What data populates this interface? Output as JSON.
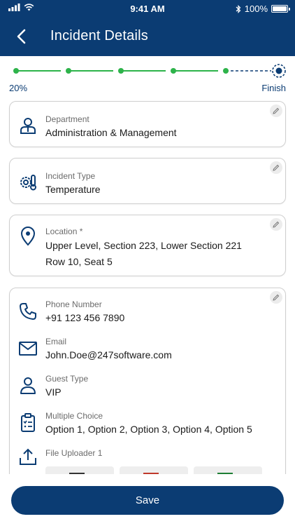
{
  "status_bar": {
    "time": "9:41 AM",
    "battery": "100%"
  },
  "header": {
    "title": "Incident Details"
  },
  "progress": {
    "start_label": "20%",
    "end_label": "Finish",
    "fraction": 0.2
  },
  "cards": {
    "department": {
      "label": "Department",
      "value": "Administration & Management"
    },
    "incident_type": {
      "label": "Incident Type",
      "value": "Temperature"
    },
    "location": {
      "label": "Location *",
      "line1": "Upper Level, Section 223, Lower Section 221",
      "line2": "Row 10,  Seat 5"
    },
    "contact": {
      "phone": {
        "label": "Phone Number",
        "value": "+91 123 456 7890"
      },
      "email": {
        "label": "Email",
        "value": "John.Doe@247software.com"
      },
      "guest_type": {
        "label": "Guest Type",
        "value": "VIP"
      },
      "multiple_choice": {
        "label": "Multiple Choice",
        "value": "Option 1, Option 2, Option 3, Option 4, Option 5"
      },
      "file_uploader": {
        "label": "File Uploader 1",
        "files": [
          "doc-file-icon",
          "pdf-file-icon",
          "xls-file-icon"
        ]
      }
    }
  },
  "footer": {
    "save_label": "Save"
  },
  "colors": {
    "primary": "#0b3c73",
    "progress_done": "#2db34a",
    "card_border": "#cfcfcf"
  }
}
